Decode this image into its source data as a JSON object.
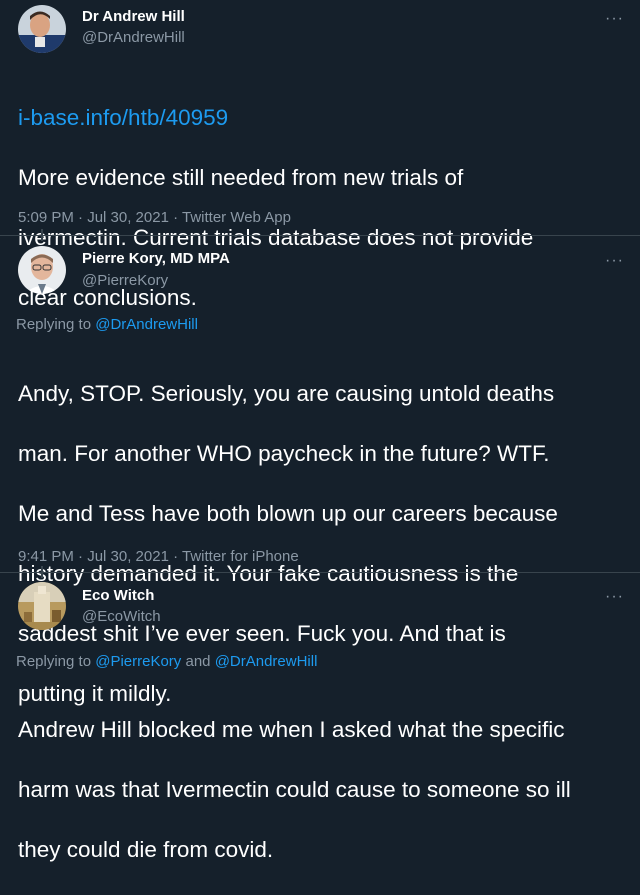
{
  "tweets": [
    {
      "name": "Dr Andrew Hill",
      "handle": "@DrAndrewHill",
      "more": "···",
      "link": "i-base.info/htb/40959",
      "body_lines": [
        "More evidence still needed from new trials of",
        "ivermectin.   Current  trials database does not provide",
        "clear conclusions."
      ],
      "meta": "5:09 PM · Jul 30, 2021 · Twitter Web App"
    },
    {
      "name": "Pierre Kory, MD MPA",
      "handle": "@PierreKory",
      "more": "···",
      "replying_prefix": "Replying to ",
      "replying_to": [
        "@DrAndrewHill"
      ],
      "body_lines": [
        "Andy, STOP. Seriously, you are causing untold deaths",
        "man. For another WHO paycheck in the future? WTF.",
        "Me and Tess have both blown up our careers because",
        "history demanded it. Your fake cautiousness is the",
        "saddest shit I’ve ever seen. Fuck you. And that is",
        "putting it mildly."
      ],
      "meta": "9:41 PM · Jul 30, 2021 · Twitter for iPhone"
    },
    {
      "name": "Eco Witch",
      "handle": "@EcoWitch",
      "more": "···",
      "replying_prefix": "Replying to ",
      "replying_to": [
        "@PierreKory",
        "@DrAndrewHill"
      ],
      "replying_join": " and ",
      "body_lines": [
        "Andrew Hill blocked me when I asked what the specific",
        "harm was that Ivermectin could cause to someone so ill",
        "they could die from covid."
      ]
    }
  ],
  "colors": {
    "background": "#15202b",
    "text": "#ffffff",
    "muted": "#8b98a5",
    "link": "#1d9bf0",
    "divider": "#38444d"
  },
  "icons": [
    "more-options-icon"
  ]
}
